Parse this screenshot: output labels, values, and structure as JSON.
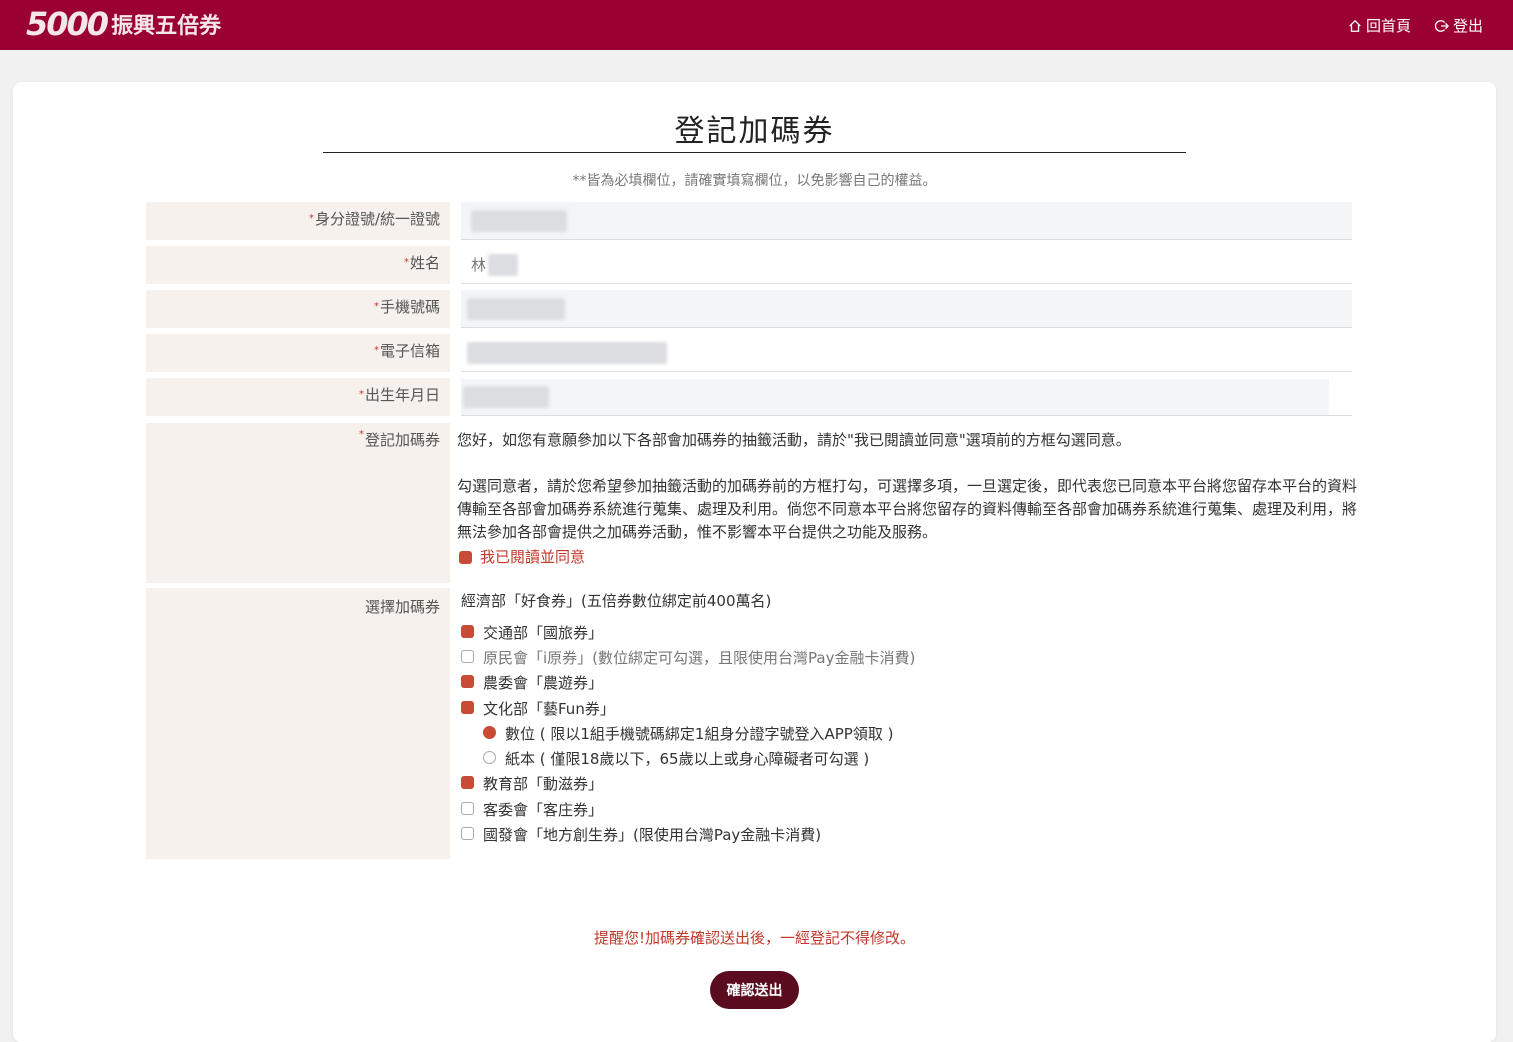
{
  "header": {
    "logo_number": "5000",
    "logo_text": "振興五倍券",
    "nav": {
      "home": "回首頁",
      "logout": "登出"
    }
  },
  "form": {
    "title": "登記加碼券",
    "note": "**皆為必填欄位，請確實填寫欄位，以免影響自己的權益。",
    "fields": {
      "id_label": "身分證號/統一證號",
      "name_label": "姓名",
      "name_value": "林",
      "phone_label": "手機號碼",
      "email_label": "電子信箱",
      "birth_label": "出生年月日",
      "register_label": "登記加碼券",
      "select_label": "選擇加碼券"
    },
    "required_mark": "*",
    "consent": {
      "p1": "您好，如您有意願參加以下各部會加碼券的抽籤活動，請於\"我已閱讀並同意\"選項前的方框勾選同意。",
      "p2": "勾選同意者，請於您希望參加抽籤活動的加碼券前的方框打勾，可選擇多項，一旦選定後，即代表您已同意本平台將您留存本平台的資料傳輸至各部會加碼券系統進行蒐集、處理及利用。倘您不同意本平台將您留存的資料傳輸至各部會加碼券系統進行蒐集、處理及利用，將無法參加各部會提供之加碼券活動，惟不影響本平台提供之功能及服務。",
      "agree": "我已閱讀並同意"
    },
    "vouchers": {
      "header": "經濟部「好食券」(五倍券數位綁定前400萬名)",
      "items": [
        {
          "label": "交通部「國旅券」",
          "checked": true
        },
        {
          "label": "原民會「i原券」(數位綁定可勾選，且限使用台灣Pay金融卡消費)",
          "checked": false
        },
        {
          "label": "農委會「農遊券」",
          "checked": true
        },
        {
          "label": "文化部「藝Fun券」",
          "checked": true
        },
        {
          "label": "數位 ( 限以1組手機號碼綁定1組身分證字號登入APP領取 )",
          "checked": true
        },
        {
          "label": "紙本 ( 僅限18歲以下，65歲以上或身心障礙者可勾選 )",
          "checked": false
        },
        {
          "label": "教育部「動滋券」",
          "checked": true
        },
        {
          "label": "客委會「客庄券」",
          "checked": false
        },
        {
          "label": "國發會「地方創生券」(限使用台灣Pay金融卡消費)",
          "checked": false
        }
      ]
    },
    "reminder": "提醒您!加碼券確認送出後，一經登記不得修改。",
    "submit": "確認送出"
  },
  "colors": {
    "header": "#9b0032",
    "accent": "#c94a35",
    "button": "#5a0b1d",
    "label_bg": "#f6f1ec"
  }
}
